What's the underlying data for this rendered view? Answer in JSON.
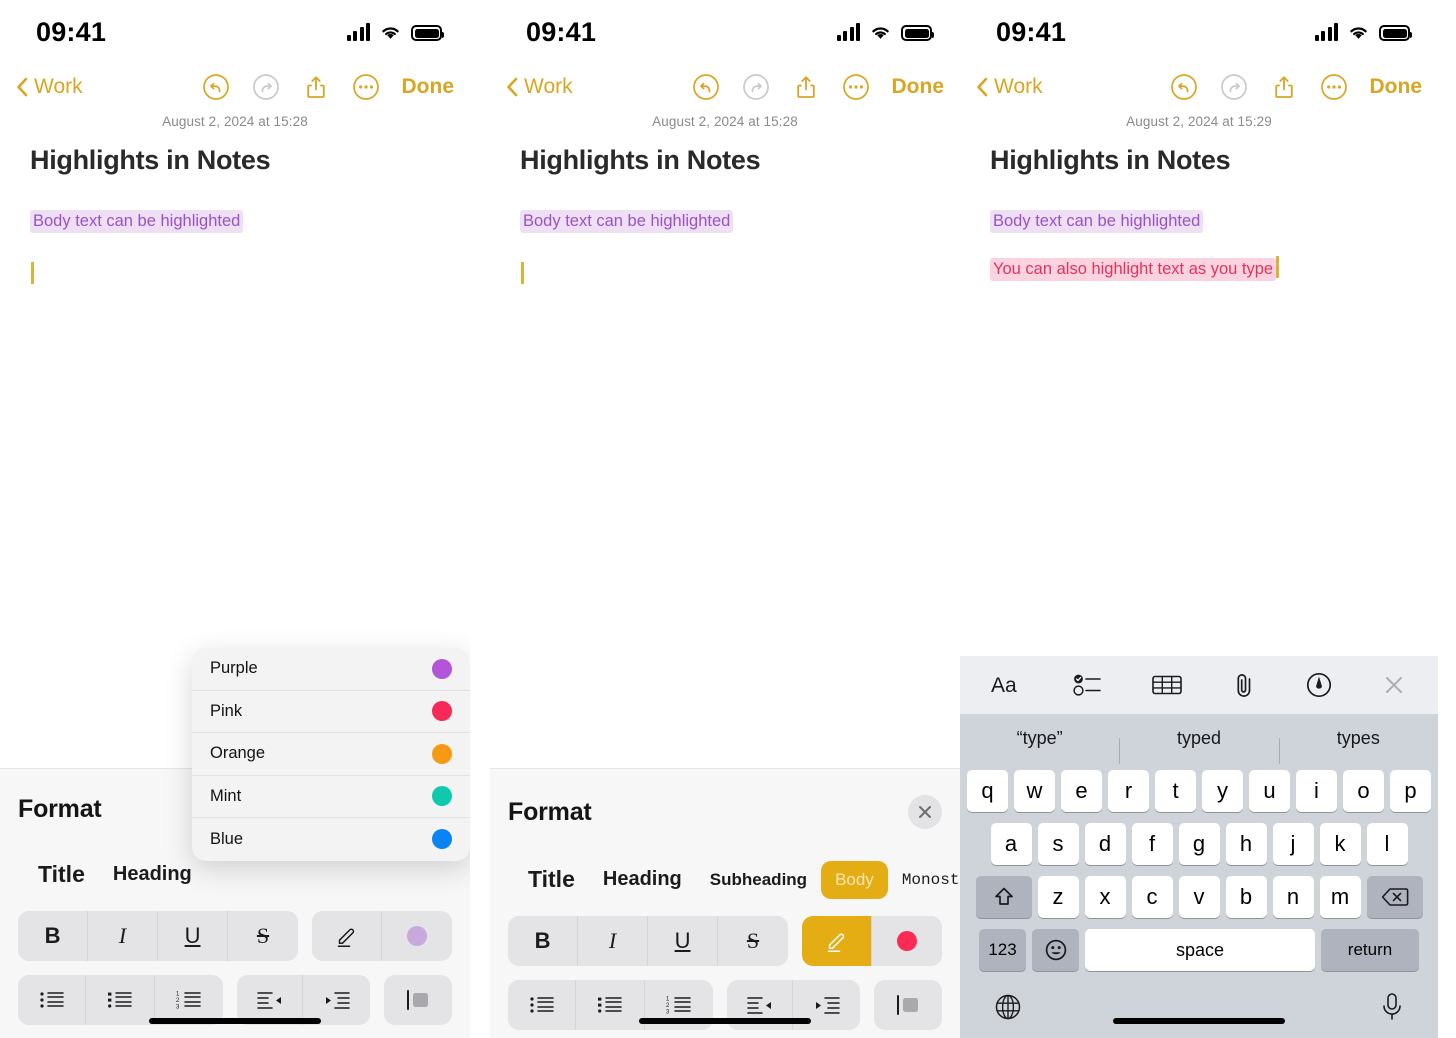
{
  "status_bar": {
    "time": "09:41",
    "signal_icon": "cellular-bars-icon",
    "wifi_icon": "wifi-icon",
    "battery_icon": "battery-full-icon"
  },
  "nav": {
    "back_label": "Work",
    "back_icon": "chevron-left-icon",
    "undo_icon": "undo-circle-icon",
    "redo_icon": "redo-circle-icon",
    "share_icon": "share-up-icon",
    "more_icon": "ellipsis-circle-icon",
    "done_label": "Done"
  },
  "note": {
    "title": "Highlights in Notes",
    "date_1528": "August 2, 2024 at 15:28",
    "date_1529": "August 2, 2024 at 15:29",
    "line_purple": "Body text can be highlighted",
    "line_pink": "You can also highlight text as you type"
  },
  "format": {
    "title": "Format",
    "close_icon": "close-x-icon",
    "styles": [
      {
        "label": "Title",
        "active": false
      },
      {
        "label": "Heading",
        "active": false
      },
      {
        "label": "Subheading",
        "active": false
      },
      {
        "label": "Body",
        "active": true
      },
      {
        "label": "Monostyled",
        "active": false
      }
    ],
    "text_buttons": [
      {
        "label": "B",
        "name": "bold-button"
      },
      {
        "label": "I",
        "name": "italic-button"
      },
      {
        "label": "U",
        "name": "underline-button"
      },
      {
        "label": "S",
        "name": "strikethrough-button"
      }
    ],
    "highlight_pen_icon": "highlighter-pen-icon",
    "swatch_purple_muted": "#c9a8dc",
    "swatch_pink": "#fa2b55",
    "active_yellow": "#e3ad13",
    "list_buttons": [
      "dashed-list-icon",
      "bulleted-list-icon",
      "numbered-list-icon"
    ],
    "indent_buttons": [
      "outdent-icon",
      "indent-icon"
    ],
    "block_button": "block-quote-icon"
  },
  "color_menu": {
    "items": [
      {
        "label": "Purple",
        "color": "#b355d8"
      },
      {
        "label": "Pink",
        "color": "#f52a56"
      },
      {
        "label": "Orange",
        "color": "#f69a16"
      },
      {
        "label": "Mint",
        "color": "#0fc9ad"
      },
      {
        "label": "Blue",
        "color": "#0b84f3"
      }
    ]
  },
  "keyboard": {
    "toolbar_icons": [
      "text-format-aa-icon",
      "checklist-icon",
      "table-icon",
      "attachment-paperclip-icon",
      "markup-pen-icon",
      "close-x-icon"
    ],
    "suggestions": [
      "“type”",
      "typed",
      "types"
    ],
    "row1": [
      "q",
      "w",
      "e",
      "r",
      "t",
      "y",
      "u",
      "i",
      "o",
      "p"
    ],
    "row2": [
      "a",
      "s",
      "d",
      "f",
      "g",
      "h",
      "j",
      "k",
      "l"
    ],
    "row3": [
      "z",
      "x",
      "c",
      "v",
      "b",
      "n",
      "m"
    ],
    "shift_icon": "shift-arrow-icon",
    "backspace_icon": "backspace-delete-icon",
    "numeric_label": "123",
    "emoji_icon": "emoji-smiley-icon",
    "space_label": "space",
    "return_label": "return",
    "globe_icon": "globe-language-icon",
    "mic_icon": "microphone-icon"
  }
}
